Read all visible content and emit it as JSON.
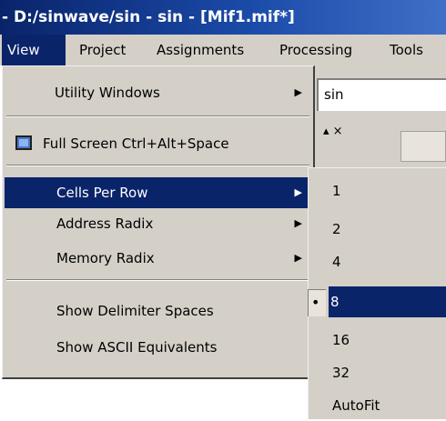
{
  "window": {
    "title": "- D:/sinwave/sin - sin - [Mif1.mif*]"
  },
  "menubar": {
    "items": [
      {
        "label": "View"
      },
      {
        "label": "Project"
      },
      {
        "label": "Assignments"
      },
      {
        "label": "Processing"
      },
      {
        "label": "Tools"
      }
    ]
  },
  "background": {
    "input_text": "sin",
    "toolbar_glyph": "▴ ×"
  },
  "view_menu": {
    "items": [
      {
        "label": "Utility Windows",
        "arrow": "▶"
      },
      {
        "label": "Full Screen Ctrl+Alt+Space",
        "icon": "fullscreen-icon"
      },
      {
        "label": "Cells Per Row",
        "arrow": "▶"
      },
      {
        "label": "Address Radix",
        "arrow": "▶"
      },
      {
        "label": "Memory Radix",
        "arrow": "▶"
      },
      {
        "label": "Show Delimiter Spaces"
      },
      {
        "label": "Show ASCII Equivalents"
      }
    ]
  },
  "cells_submenu": {
    "items": [
      {
        "label": "1"
      },
      {
        "label": "2"
      },
      {
        "label": "4"
      },
      {
        "label": "8",
        "radio": "•"
      },
      {
        "label": "16"
      },
      {
        "label": "32"
      },
      {
        "label": "AutoFit"
      }
    ]
  },
  "colors": {
    "highlight": "#0a246a",
    "menu_bg": "#d4d0c8"
  }
}
